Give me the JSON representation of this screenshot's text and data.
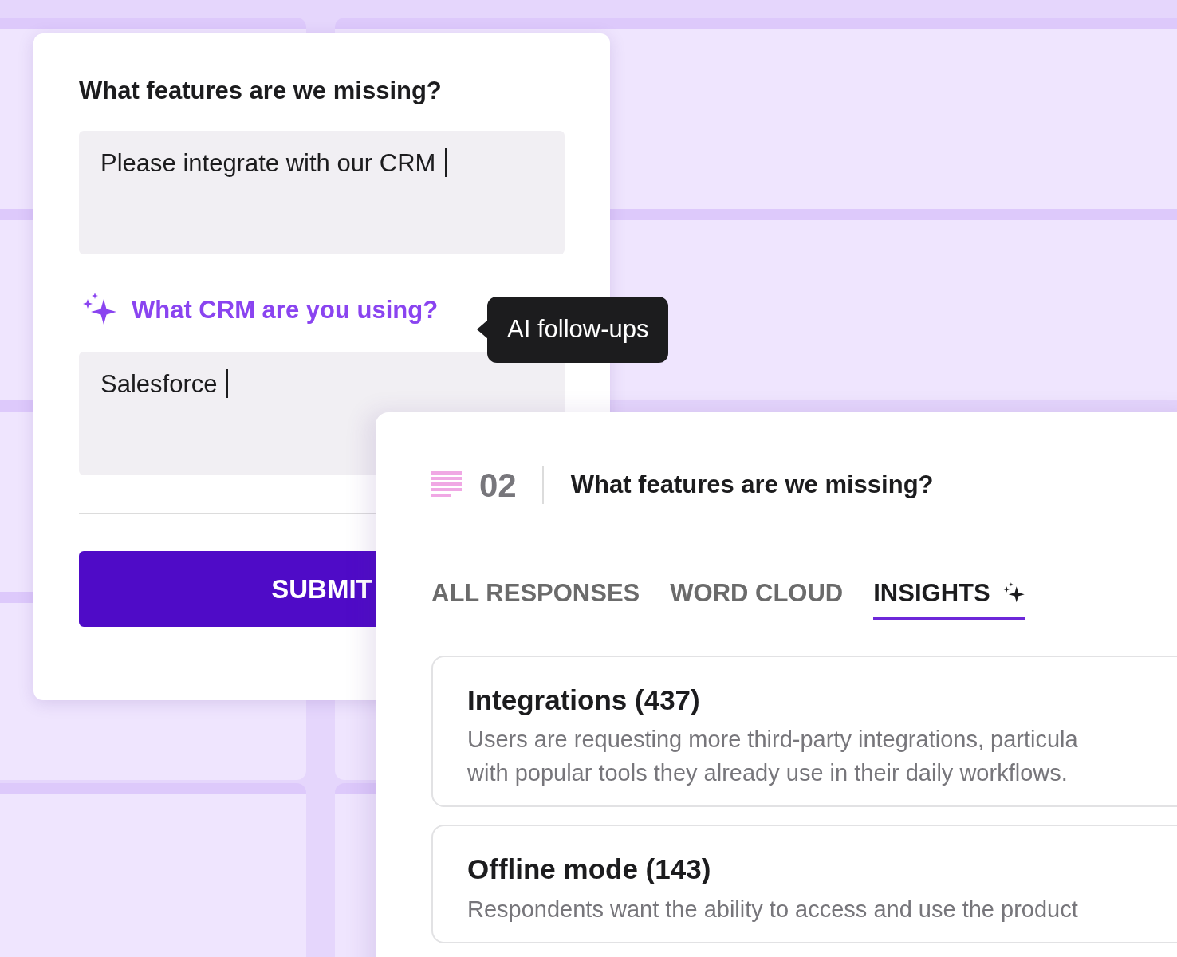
{
  "form": {
    "question": "What features are we missing?",
    "answers": [
      {
        "value": "Please integrate with our CRM"
      },
      {
        "value": "Salesforce"
      }
    ],
    "follow_up": "What CRM are you using?",
    "tooltip": "AI follow-ups",
    "submit": "SUBMIT"
  },
  "results": {
    "number": "02",
    "question": "What features are we missing?",
    "tabs": [
      {
        "label": "ALL RESPONSES",
        "selected": false,
        "ai": false
      },
      {
        "label": "WORD CLOUD",
        "selected": false,
        "ai": false
      },
      {
        "label": "INSIGHTS",
        "selected": true,
        "ai": true
      }
    ],
    "insights": [
      {
        "title": "Integrations (437)",
        "lines": [
          "Users are requesting more third-party integrations, particula",
          "with popular tools they already use in their daily workflows."
        ]
      },
      {
        "title": "Offline mode (143)",
        "lines": [
          "Respondents want the ability to access and use the product"
        ]
      }
    ]
  }
}
